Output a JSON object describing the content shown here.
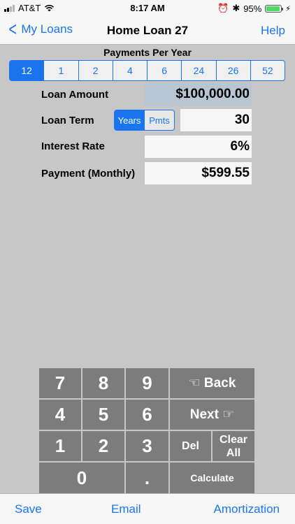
{
  "status_bar": {
    "carrier": "AT&T",
    "time": "8:17 AM",
    "battery_percent": "95%",
    "battery_level": 0.95,
    "icons": [
      "signal-icon",
      "wifi-icon",
      "alarm-icon",
      "bluetooth-icon",
      "battery-icon",
      "charging-icon"
    ]
  },
  "nav": {
    "back_label": "My Loans",
    "title": "Home Loan 27",
    "help_label": "Help"
  },
  "payments_per_year": {
    "label": "Payments Per Year",
    "options": [
      "12",
      "1",
      "2",
      "4",
      "6",
      "24",
      "26",
      "52"
    ],
    "selected": "12"
  },
  "form": {
    "loan_amount": {
      "label": "Loan Amount",
      "value": "$100,000.00"
    },
    "loan_term": {
      "label": "Loan Term",
      "value": "30",
      "units": [
        "Years",
        "Pmts"
      ],
      "selected_unit": "Years"
    },
    "interest_rate": {
      "label": "Interest Rate",
      "value": "6%"
    },
    "payment": {
      "label": "Payment (Monthly)",
      "value": "$599.55"
    }
  },
  "keypad": {
    "keys": {
      "k7": "7",
      "k8": "8",
      "k9": "9",
      "k4": "4",
      "k5": "5",
      "k6": "6",
      "k1": "1",
      "k2": "2",
      "k3": "3",
      "k0": "0",
      "dot": ".",
      "back": "☜ Back",
      "next": "Next ☞",
      "del": "Del",
      "clear_line1": "Clear",
      "clear_line2": "All",
      "calculate": "Calculate"
    }
  },
  "toolbar": {
    "save_label": "Save",
    "email_label": "Email",
    "amortization_label": "Amortization"
  },
  "colors": {
    "accent": "#1a74f0",
    "background": "#c7c7c7",
    "keypad_key": "#7c7c7c",
    "selected_field": "#b8c6d3",
    "battery_fill": "#4cd964"
  }
}
